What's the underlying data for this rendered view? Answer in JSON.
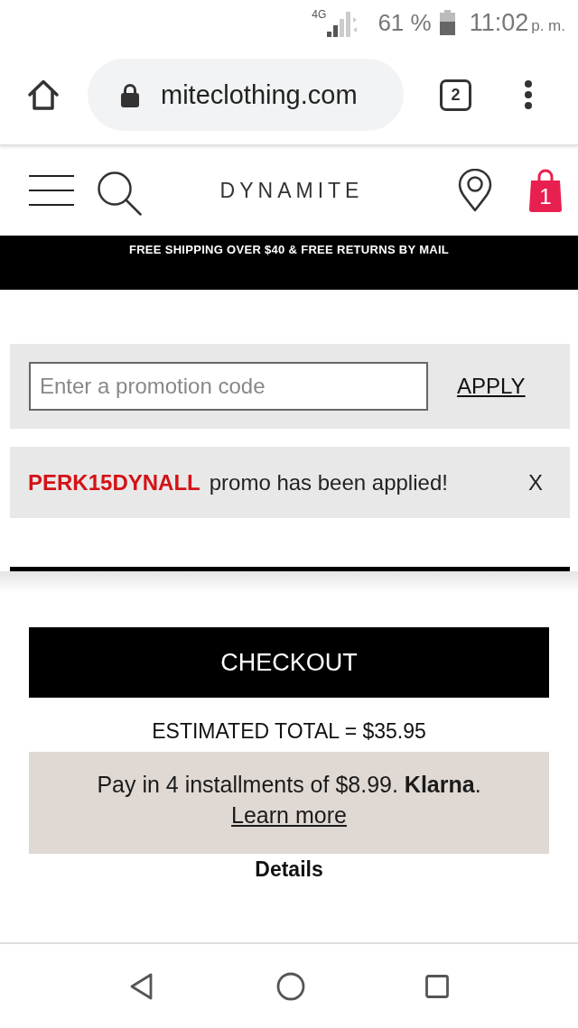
{
  "status_bar": {
    "network": "4G",
    "battery": "61 %",
    "time": "11:02",
    "time_suffix": "p. m."
  },
  "browser": {
    "url": "miteclothing.com",
    "tab_count": "2"
  },
  "site_header": {
    "logo": "DYNAMITE",
    "cart_count": "1"
  },
  "banner": "FREE SHIPPING OVER $40 & FREE RETURNS BY MAIL",
  "promo_form": {
    "placeholder": "Enter a promotion code",
    "apply": "APPLY"
  },
  "promo_applied": {
    "code": "PERK15DYNALL",
    "message": "promo has been applied!",
    "close": "X"
  },
  "checkout": {
    "button": "CHECKOUT",
    "estimated_total": "ESTIMATED TOTAL = $35.95"
  },
  "klarna": {
    "text": "Pay in 4 installments of $8.99. **Klarna**.",
    "link": "Learn more"
  },
  "details": "Details"
}
